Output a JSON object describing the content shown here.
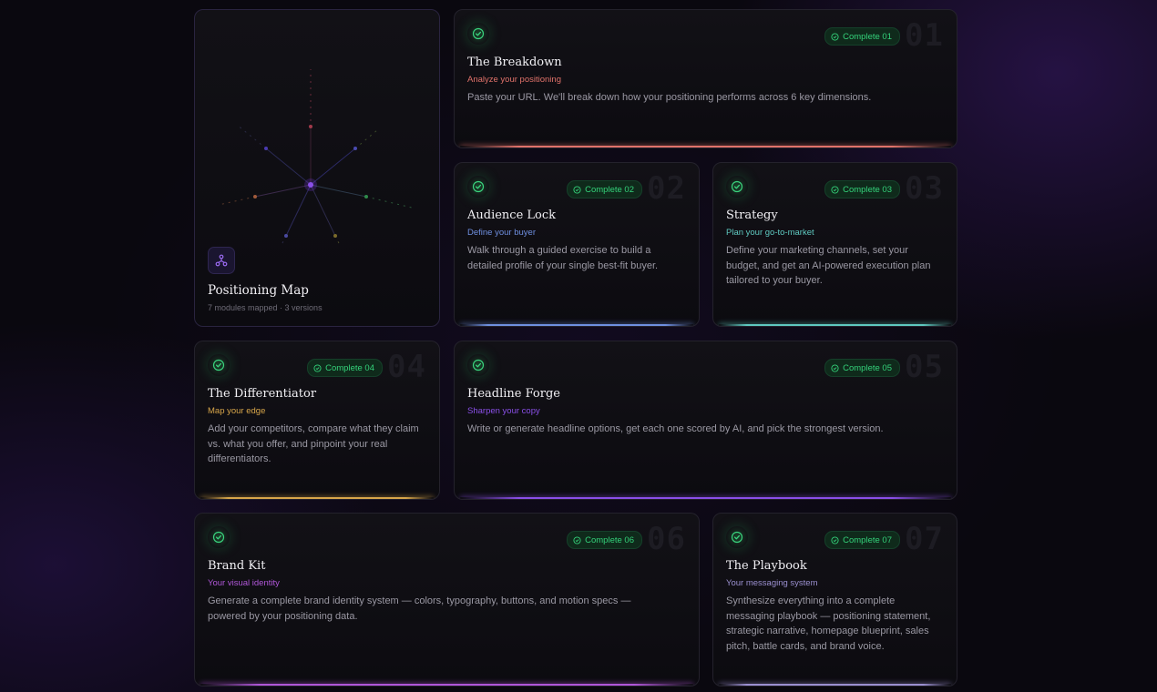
{
  "positioning_map": {
    "title": "Positioning Map",
    "subtitle": "7 modules mapped · 3 versions",
    "icon": "network-icon"
  },
  "modules": [
    {
      "number": "01",
      "status": "Complete 01",
      "title": "The Breakdown",
      "subtitle": "Analyze your positioning",
      "description": "Paste your URL. We'll break down how your positioning performs across 6 key dimensions.",
      "accent": "#e0726a"
    },
    {
      "number": "02",
      "status": "Complete 02",
      "title": "Audience Lock",
      "subtitle": "Define your buyer",
      "description": "Walk through a guided exercise to build a detailed profile of your single best-fit buyer.",
      "accent": "#6f8fe0"
    },
    {
      "number": "03",
      "status": "Complete 03",
      "title": "Strategy",
      "subtitle": "Plan your go-to-market",
      "description": "Define your marketing channels, set your budget, and get an AI-powered execution plan tailored to your buyer.",
      "accent": "#5fc9c0"
    },
    {
      "number": "04",
      "status": "Complete 04",
      "title": "The Differentiator",
      "subtitle": "Map your edge",
      "description": "Add your competitors, compare what they claim vs. what you offer, and pinpoint your real differentiators.",
      "accent": "#d8a64a"
    },
    {
      "number": "05",
      "status": "Complete 05",
      "title": "Headline Forge",
      "subtitle": "Sharpen your copy",
      "description": "Write or generate headline options, get each one scored by AI, and pick the strongest version.",
      "accent": "#8a4fe8"
    },
    {
      "number": "06",
      "status": "Complete 06",
      "title": "Brand Kit",
      "subtitle": "Your visual identity",
      "description": "Generate a complete brand identity system — colors, typography, buttons, and motion specs — powered by your positioning data.",
      "accent": "#b056d8"
    },
    {
      "number": "07",
      "status": "Complete 07",
      "title": "The Playbook",
      "subtitle": "Your messaging system",
      "description": "Synthesize everything into a complete messaging playbook — positioning statement, strategic narrative, homepage blueprint, sales pitch, battle cards, and brand voice.",
      "accent": "#9b8fd0"
    }
  ],
  "colors": {
    "complete": "#34d27a",
    "background": "#0a080f",
    "card": "#121116"
  }
}
